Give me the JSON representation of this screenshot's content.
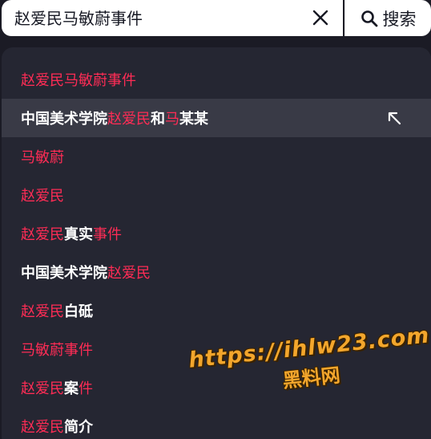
{
  "search": {
    "value": "赵爱民马敏蔚事件",
    "button_label": "搜索"
  },
  "colors": {
    "highlight": "#fe2c55",
    "text": "#ffffff",
    "dropdown_bg": "#252632",
    "hover_bg": "#393a46"
  },
  "icons": {
    "clear": "close-icon",
    "search": "search-icon",
    "fill": "arrow-up-left-icon"
  },
  "suggestions": [
    {
      "segments": [
        {
          "text": "赵爱民马敏蔚事件",
          "hl": true
        }
      ]
    },
    {
      "hovered": true,
      "segments": [
        {
          "text": "中国美术学院",
          "hl": false
        },
        {
          "text": "赵爱民",
          "hl": true
        },
        {
          "text": "和",
          "hl": false
        },
        {
          "text": "马",
          "hl": true
        },
        {
          "text": "某某",
          "hl": false
        }
      ]
    },
    {
      "segments": [
        {
          "text": "马敏蔚",
          "hl": true
        }
      ]
    },
    {
      "segments": [
        {
          "text": "赵爱民",
          "hl": true
        }
      ]
    },
    {
      "segments": [
        {
          "text": "赵爱民",
          "hl": true
        },
        {
          "text": "真实",
          "hl": false
        },
        {
          "text": "事件",
          "hl": true
        }
      ]
    },
    {
      "segments": [
        {
          "text": "中国美术学院",
          "hl": false
        },
        {
          "text": "赵爱民",
          "hl": true
        }
      ]
    },
    {
      "segments": [
        {
          "text": "赵爱民",
          "hl": true
        },
        {
          "text": "白砥",
          "hl": false
        }
      ]
    },
    {
      "segments": [
        {
          "text": "马敏蔚事件",
          "hl": true
        }
      ]
    },
    {
      "segments": [
        {
          "text": "赵爱民",
          "hl": true
        },
        {
          "text": "案",
          "hl": false
        },
        {
          "text": "件",
          "hl": true
        }
      ]
    },
    {
      "segments": [
        {
          "text": "赵爱民",
          "hl": true
        },
        {
          "text": "简介",
          "hl": false
        }
      ]
    }
  ],
  "watermark": {
    "url": "https://ihlw23.com",
    "name": "黑料网"
  }
}
